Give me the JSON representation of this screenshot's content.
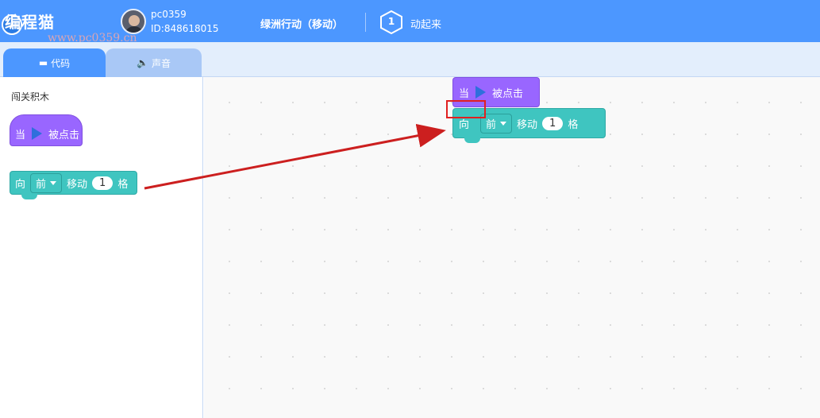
{
  "header": {
    "logo_text": "编程猫",
    "watermark": "www.pc0359.cn",
    "user_name": "pc0359",
    "user_id": "ID:848618015",
    "level_title": "绿洲行动（移动）",
    "step_number": "1",
    "step_label": "动起来",
    "accent_color": "#4c97ff"
  },
  "tabs": [
    {
      "label": "代码",
      "icon": "code-block-icon",
      "active": true
    },
    {
      "label": "声音",
      "icon": "speaker-icon",
      "active": false
    }
  ],
  "palette": {
    "title": "闯关积木",
    "hat_block": {
      "prefix": "当",
      "icon": "green-flag-play-icon",
      "suffix": "被点击",
      "color": "#9966ff"
    },
    "move_block": {
      "prefix": "向",
      "direction": "前",
      "action": "移动",
      "steps": "1",
      "unit": "格",
      "color": "#3fc5c0"
    }
  },
  "workspace": {
    "hat_block": {
      "prefix": "当",
      "suffix": "被点击"
    },
    "move_block": {
      "prefix": "向",
      "direction": "前",
      "action": "移动",
      "steps": "1",
      "unit": "格"
    }
  },
  "annotation": {
    "box_color": "#e02020",
    "arrow_color": "#cc1f1f"
  }
}
